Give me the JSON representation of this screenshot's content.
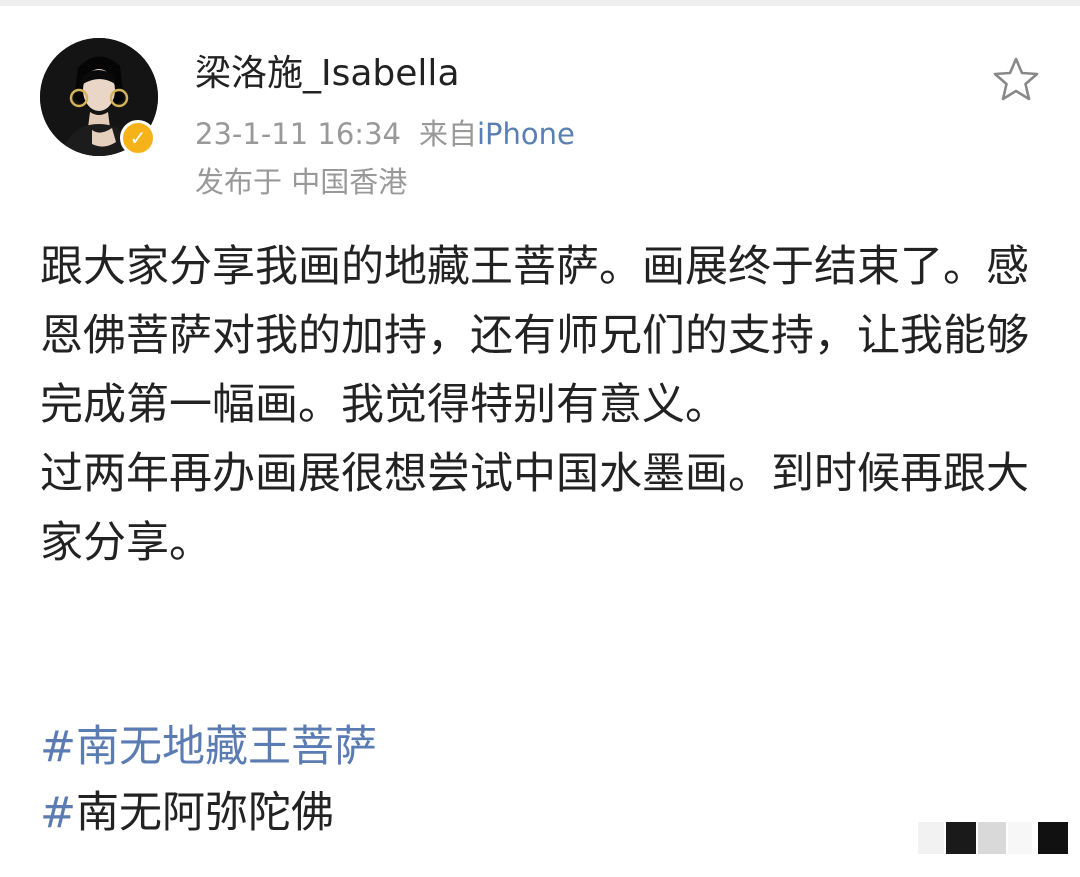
{
  "post": {
    "username": "梁洛施_Isabella",
    "timestamp": "23-1-11 16:34",
    "source_prefix": "来自",
    "source_device": "iPhone",
    "location": "发布于 中国香港",
    "paragraphs": [
      "跟大家分享我画的地藏王菩萨。画展终于结束了。感恩佛菩萨对我的加持，还有师兄们的支持，让我能够完成第一幅画。我觉得特别有意义。",
      "过两年再办画展很想尝试中国水墨画。到时候再跟大家分享。"
    ],
    "hashtags": [
      {
        "hash": "#",
        "text": "南无地藏王菩萨"
      },
      {
        "hash": "#",
        "text": "南无阿弥陀佛"
      }
    ]
  },
  "icons": {
    "avatar": "avatar-photo",
    "verified": "verified-badge-icon",
    "favorite": "star-outline-icon"
  },
  "colors": {
    "link": "#5b7bb3",
    "meta": "#999999",
    "text": "#222222",
    "verified": "#f5b319"
  }
}
